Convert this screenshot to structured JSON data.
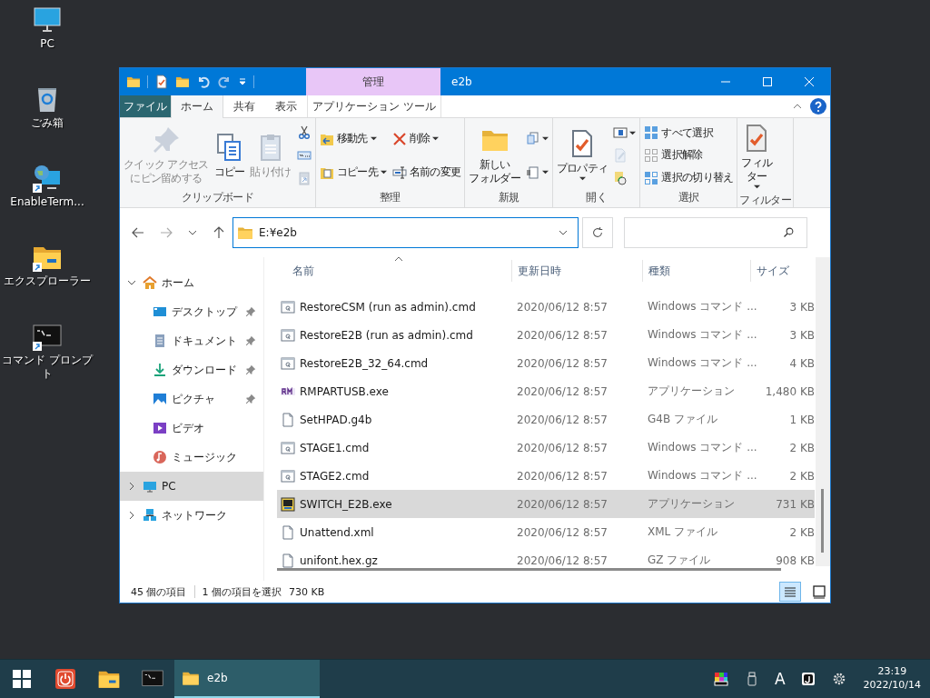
{
  "desktop_icons": [
    {
      "label": "PC",
      "shortcut": false
    },
    {
      "label": "ごみ箱",
      "shortcut": false
    },
    {
      "label": "EnableTerm...",
      "shortcut": true
    },
    {
      "label": "エクスプローラー",
      "shortcut": true
    },
    {
      "label": "コマンド プロンプト",
      "shortcut": true
    }
  ],
  "window": {
    "title": "e2b",
    "context_group": "管理",
    "tabs": [
      {
        "label": "ファイル",
        "kind": "file",
        "selected": false
      },
      {
        "label": "ホーム",
        "kind": "tab",
        "selected": true
      },
      {
        "label": "共有",
        "kind": "tab",
        "selected": false
      },
      {
        "label": "表示",
        "kind": "tab",
        "selected": false
      },
      {
        "label": "アプリケーション ツール",
        "kind": "context",
        "selected": false
      }
    ],
    "ribbon": [
      {
        "label": "クリップボード",
        "columns": [
          [
            {
              "kind": "large",
              "lines": [
                "クイック アクセス",
                "にピン留めする"
              ],
              "disabled": true,
              "dropdown": false
            }
          ],
          [
            {
              "kind": "large",
              "lines": [
                "コピー"
              ],
              "disabled": false,
              "dropdown": false
            }
          ],
          [
            {
              "kind": "large",
              "lines": [
                "貼り付け"
              ],
              "disabled": true,
              "dropdown": false
            }
          ],
          [
            {
              "kind": "mini",
              "disabled": false,
              "dropdown": false
            },
            {
              "kind": "mini",
              "disabled": false,
              "dropdown": false
            },
            {
              "kind": "mini",
              "disabled": true,
              "dropdown": false
            }
          ]
        ]
      },
      {
        "label": "整理",
        "columns": [
          [
            {
              "kind": "small",
              "label": "移動先",
              "disabled": false,
              "dropdown": true
            },
            {
              "kind": "small",
              "label": "コピー先",
              "disabled": false,
              "dropdown": true
            }
          ],
          [
            {
              "kind": "small",
              "label": "削除",
              "disabled": false,
              "dropdown": true
            },
            {
              "kind": "small",
              "label": "名前の変更",
              "disabled": false,
              "dropdown": false
            }
          ]
        ]
      },
      {
        "label": "新規",
        "columns": [
          [
            {
              "kind": "large",
              "lines": [
                "新しい",
                "フォルダー"
              ],
              "disabled": false,
              "dropdown": false
            }
          ],
          [
            {
              "kind": "mini",
              "disabled": false,
              "dropdown": true
            },
            {
              "kind": "mini",
              "disabled": false,
              "dropdown": true
            }
          ]
        ]
      },
      {
        "label": "開く",
        "columns": [
          [
            {
              "kind": "large",
              "lines": [
                "プロパティ"
              ],
              "disabled": false,
              "dropdown": true
            }
          ],
          [
            {
              "kind": "mini",
              "disabled": false,
              "dropdown": true
            },
            {
              "kind": "mini",
              "disabled": true,
              "dropdown": false
            },
            {
              "kind": "mini",
              "disabled": false,
              "dropdown": false
            }
          ]
        ]
      },
      {
        "label": "選択",
        "columns": [
          [
            {
              "kind": "small",
              "label": "すべて選択",
              "disabled": false,
              "dropdown": false
            },
            {
              "kind": "small",
              "label": "選択解除",
              "disabled": false,
              "dropdown": false
            },
            {
              "kind": "small",
              "label": "選択の切り替え",
              "disabled": false,
              "dropdown": false
            }
          ]
        ]
      },
      {
        "label": "フィルター",
        "columns": [
          [
            {
              "kind": "large",
              "lines": [
                "フィル",
                "ター"
              ],
              "disabled": false,
              "dropdown": true
            }
          ]
        ]
      }
    ],
    "address": "E:¥e2b",
    "nav": [
      {
        "label": "ホーム",
        "expanded": true,
        "selected": false,
        "children": [
          {
            "label": "デスクトップ",
            "pinned": true,
            "selected": false
          },
          {
            "label": "ドキュメント",
            "pinned": true,
            "selected": false
          },
          {
            "label": "ダウンロード",
            "pinned": true,
            "selected": false
          },
          {
            "label": "ピクチャ",
            "pinned": true,
            "selected": false
          },
          {
            "label": "ビデオ",
            "pinned": false,
            "selected": false
          },
          {
            "label": "ミュージック",
            "pinned": false,
            "selected": false
          }
        ]
      },
      {
        "label": "PC",
        "expanded": false,
        "selected": true
      },
      {
        "label": "ネットワーク",
        "expanded": false,
        "selected": false
      }
    ],
    "columns": [
      {
        "label": "名前",
        "sorted": true
      },
      {
        "label": "更新日時",
        "sorted": false
      },
      {
        "label": "種類",
        "sorted": false
      },
      {
        "label": "サイズ",
        "sorted": false
      }
    ],
    "rows": [
      {
        "kind": "script",
        "name": "RestoreCSM (run as admin).cmd",
        "date": "2020/06/12 8:57",
        "type": "Windows コマンド ...",
        "size": "3 KB",
        "selected": false
      },
      {
        "kind": "script",
        "name": "RestoreE2B (run as admin).cmd",
        "date": "2020/06/12 8:57",
        "type": "Windows コマンド ...",
        "size": "3 KB",
        "selected": false
      },
      {
        "kind": "script",
        "name": "RestoreE2B_32_64.cmd",
        "date": "2020/06/12 8:57",
        "type": "Windows コマンド ...",
        "size": "4 KB",
        "selected": false
      },
      {
        "kind": "rmapp",
        "name": "RMPARTUSB.exe",
        "date": "2020/06/12 8:57",
        "type": "アプリケーション",
        "size": "1,480 KB",
        "selected": false
      },
      {
        "kind": "document",
        "name": "SetHPAD.g4b",
        "date": "2020/06/12 8:57",
        "type": "G4B ファイル",
        "size": "1 KB",
        "selected": false
      },
      {
        "kind": "script",
        "name": "STAGE1.cmd",
        "date": "2020/06/12 8:57",
        "type": "Windows コマンド ...",
        "size": "2 KB",
        "selected": false
      },
      {
        "kind": "script",
        "name": "STAGE2.cmd",
        "date": "2020/06/12 8:57",
        "type": "Windows コマンド ...",
        "size": "2 KB",
        "selected": false
      },
      {
        "kind": "app",
        "name": "SWITCH_E2B.exe",
        "date": "2020/06/12 8:57",
        "type": "アプリケーション",
        "size": "731 KB",
        "selected": true
      },
      {
        "kind": "document",
        "name": "Unattend.xml",
        "date": "2020/06/12 8:57",
        "type": "XML ファイル",
        "size": "2 KB",
        "selected": false
      },
      {
        "kind": "document",
        "name": "unifont.hex.gz",
        "date": "2020/06/12 8:57",
        "type": "GZ ファイル",
        "size": "908 KB",
        "selected": false
      }
    ],
    "status": {
      "item_count": "45 個の項目",
      "selection": "1 個の項目を選択",
      "selection_size": "730 KB"
    },
    "view_buttons": [
      {
        "selected": true
      },
      {
        "selected": false
      }
    ]
  },
  "taskbar": {
    "window_button": {
      "label": "e2b",
      "active": true
    },
    "input_indicator": "A",
    "time": "23:19",
    "date": "2022/10/14"
  }
}
